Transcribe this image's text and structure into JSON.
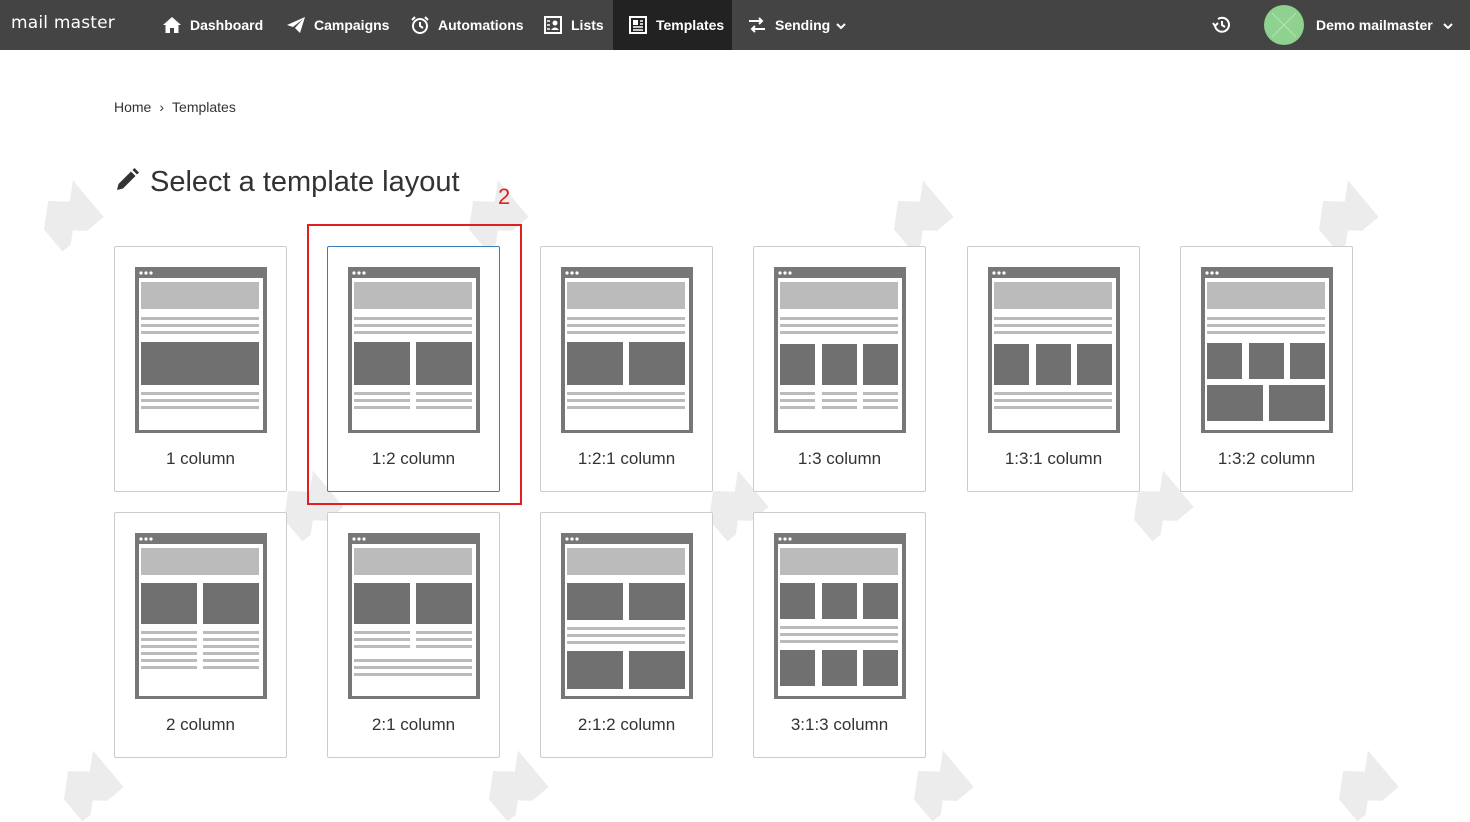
{
  "app": {
    "brand": "mail master"
  },
  "nav": {
    "items": [
      {
        "label": "Dashboard",
        "icon": "home-icon"
      },
      {
        "label": "Campaigns",
        "icon": "paper-plane-icon"
      },
      {
        "label": "Automations",
        "icon": "alarm-clock-icon"
      },
      {
        "label": "Lists",
        "icon": "contacts-icon"
      },
      {
        "label": "Templates",
        "icon": "newspaper-icon",
        "active": true
      },
      {
        "label": "Sending",
        "icon": "swap-arrows-icon",
        "dropdown": true
      }
    ],
    "history_icon": "history-icon",
    "user_name": "Demo mailmaster"
  },
  "breadcrumb": {
    "home": "Home",
    "separator": "›",
    "current": "Templates"
  },
  "page": {
    "title": "Select a template layout",
    "title_icon": "pencil-icon"
  },
  "templates": [
    {
      "label": "1 column",
      "layout": "1"
    },
    {
      "label": "1:2 column",
      "layout": "1:2",
      "selected": true
    },
    {
      "label": "1:2:1 column",
      "layout": "1:2:1"
    },
    {
      "label": "1:3 column",
      "layout": "1:3"
    },
    {
      "label": "1:3:1 column",
      "layout": "1:3:1"
    },
    {
      "label": "1:3:2 column",
      "layout": "1:3:2"
    },
    {
      "label": "2 column",
      "layout": "2"
    },
    {
      "label": "2:1 column",
      "layout": "2:1"
    },
    {
      "label": "2:1:2 column",
      "layout": "2:1:2"
    },
    {
      "label": "3:1:3 column",
      "layout": "3:1:3"
    }
  ],
  "annotation": {
    "number": "2",
    "color": "#e01f1f"
  },
  "colors": {
    "nav_bg": "#444444",
    "nav_active_bg": "#222222",
    "avatar": "#8fd18f",
    "selected_border": "#3b7dbf"
  }
}
